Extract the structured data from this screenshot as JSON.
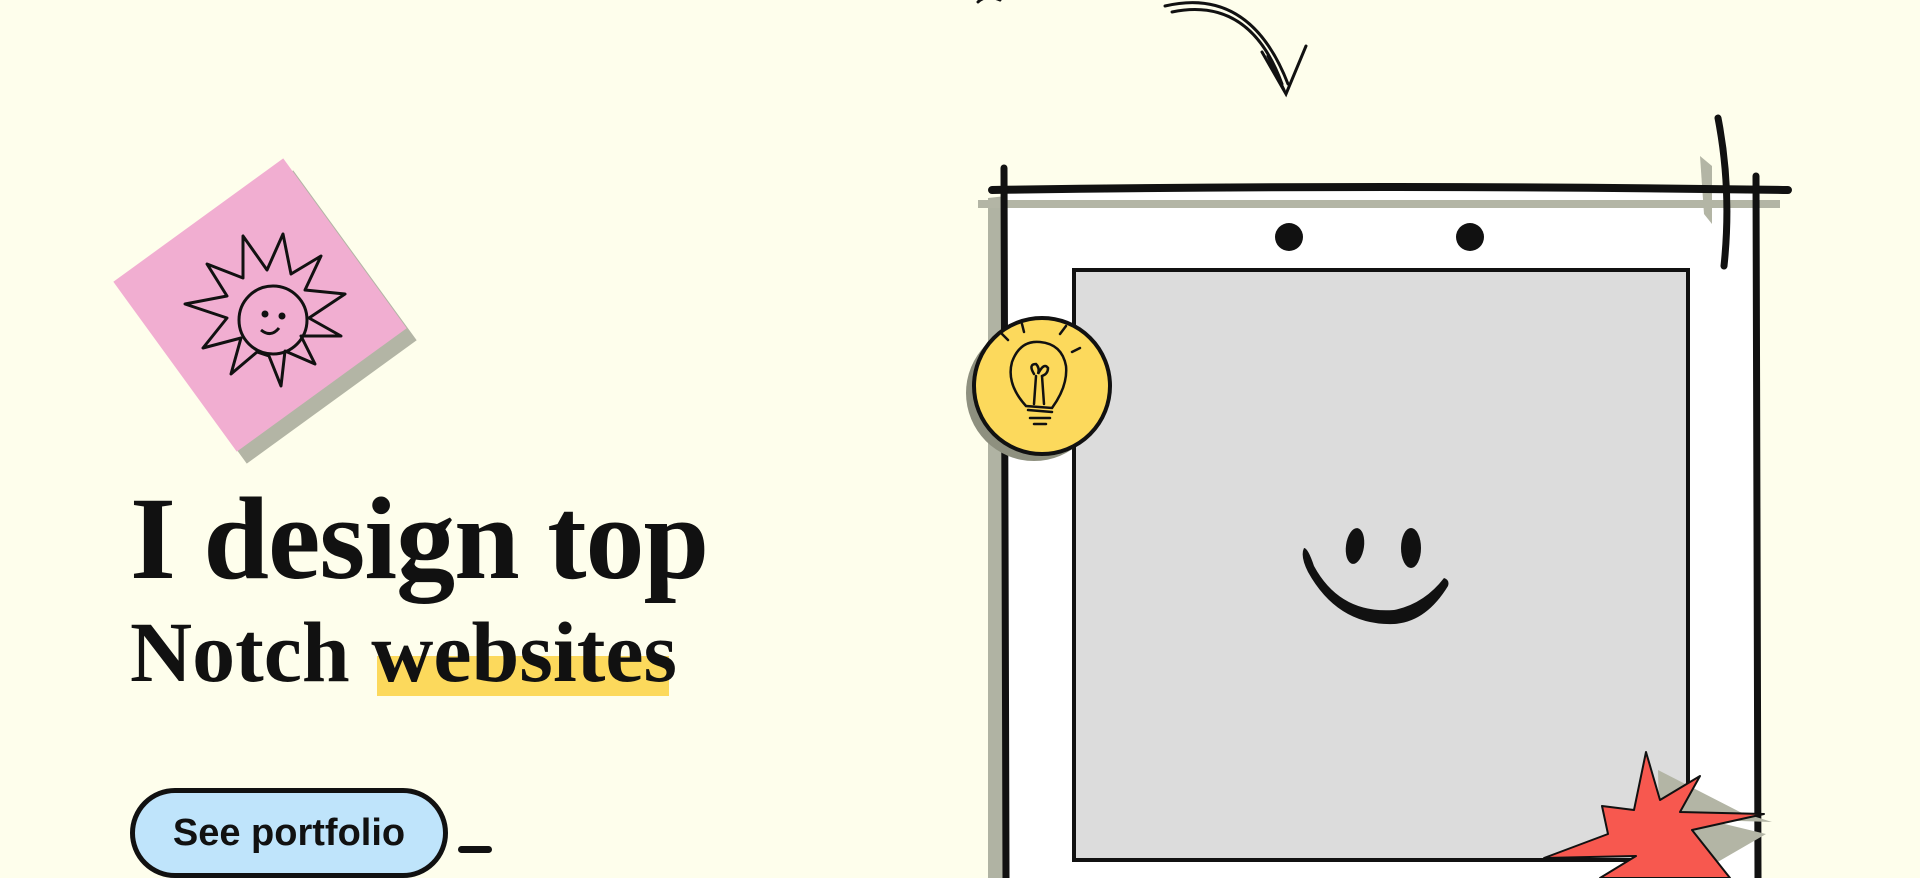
{
  "hero": {
    "headline_line1": "I design top",
    "headline_line2_prefix": "Notch ",
    "headline_line2_highlight": "websites",
    "cta_label": "See portfolio"
  },
  "colors": {
    "background": "#fefeec",
    "sticky_note": "#f1aed1",
    "highlight": "#fcd95c",
    "button": "#bfe4fb",
    "bulb_sticker": "#fcd95c",
    "star_sticker": "#f7584f",
    "polaroid_frame": "#ffffff",
    "polaroid_photo": "#dcdcdc"
  },
  "icons": [
    "sun-doodle-icon",
    "lightbulb-icon",
    "smiley-icon",
    "curved-arrow-icon",
    "starburst-icon"
  ]
}
